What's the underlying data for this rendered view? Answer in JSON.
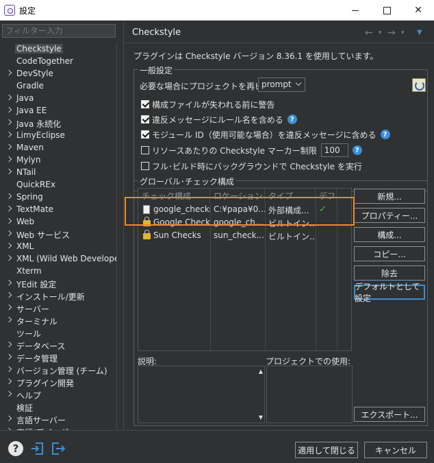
{
  "window": {
    "title": "設定"
  },
  "filter": {
    "placeholder": "フィルター入力"
  },
  "tree": [
    {
      "label": "Checkstyle",
      "expandable": false,
      "selected": true
    },
    {
      "label": "CodeTogether",
      "expandable": false
    },
    {
      "label": "DevStyle",
      "expandable": true
    },
    {
      "label": "Gradle",
      "expandable": false
    },
    {
      "label": "Java",
      "expandable": true
    },
    {
      "label": "Java EE",
      "expandable": true
    },
    {
      "label": "Java 永続化",
      "expandable": true
    },
    {
      "label": "LimyEclipse",
      "expandable": true
    },
    {
      "label": "Maven",
      "expandable": true
    },
    {
      "label": "Mylyn",
      "expandable": true
    },
    {
      "label": "NTail",
      "expandable": true
    },
    {
      "label": "QuickREx",
      "expandable": false
    },
    {
      "label": "Spring",
      "expandable": true
    },
    {
      "label": "TextMate",
      "expandable": true
    },
    {
      "label": "Web",
      "expandable": true
    },
    {
      "label": "Web サービス",
      "expandable": true
    },
    {
      "label": "XML",
      "expandable": true
    },
    {
      "label": "XML (Wild Web Developer",
      "expandable": true
    },
    {
      "label": "Xterm",
      "expandable": false
    },
    {
      "label": "YEdit 設定",
      "expandable": true
    },
    {
      "label": "インストール/更新",
      "expandable": true
    },
    {
      "label": "サーバー",
      "expandable": true
    },
    {
      "label": "ターミナル",
      "expandable": true
    },
    {
      "label": "ツール",
      "expandable": false
    },
    {
      "label": "データベース",
      "expandable": true
    },
    {
      "label": "データ管理",
      "expandable": true
    },
    {
      "label": "バージョン管理 (チーム)",
      "expandable": true
    },
    {
      "label": "プラグイン開発",
      "expandable": true
    },
    {
      "label": "ヘルプ",
      "expandable": true
    },
    {
      "label": "検証",
      "expandable": false
    },
    {
      "label": "言語サーバー",
      "expandable": true
    },
    {
      "label": "実行/デバッグ",
      "expandable": true
    }
  ],
  "page": {
    "title": "Checkstyle",
    "version_line": "プラグインは Checkstyle バージョン 8.36.1 を使用しています。"
  },
  "general": {
    "legend": "一般設定",
    "rebuild_label": "必要な場合にプロジェクトを再ビルド:",
    "rebuild_value": "prompt",
    "options": [
      {
        "label": "構成ファイルが失われる前に警告",
        "checked": true,
        "help": false
      },
      {
        "label": "違反メッセージにルール名を含める",
        "checked": true,
        "help": true
      },
      {
        "label": "モジュール ID（使用可能な場合）を違反メッセージに含める",
        "checked": true,
        "help": true
      },
      {
        "label": "リソースあたりの Checkstyle マーカー制限",
        "checked": false,
        "help": true
      },
      {
        "label": "フル･ビルド時にバックグラウンドで Checkstyle を実行",
        "checked": false,
        "help": false
      }
    ],
    "marker_limit": "100"
  },
  "global": {
    "legend": "グローバル･チェック構成",
    "columns": [
      "チェック構成",
      "ロケーション",
      "タイプ",
      "デフ..."
    ],
    "rows": [
      {
        "name": "google_checks",
        "location": "C:¥papa¥0...",
        "type": "外部構成...",
        "default": "✓",
        "icon": "file"
      },
      {
        "name": "Google Checks",
        "location": "google_ch...",
        "type": "ビルトイン...",
        "default": "",
        "icon": "lock"
      },
      {
        "name": "Sun Checks",
        "location": "sun_check...",
        "type": "ビルトイン...",
        "default": "",
        "icon": "lock"
      }
    ],
    "buttons": {
      "new": "新規...",
      "properties": "プロパティー...",
      "configure": "構成...",
      "copy": "コピー...",
      "remove": "除去",
      "set_default": "デフォルトとして設定",
      "export": "エクスポート..."
    },
    "description_label": "説明:",
    "usage_label": "プロジェクトでの使用:"
  },
  "footer": {
    "apply_close": "適用して閉じる",
    "cancel": "キャンセル",
    "help_glyph": "?"
  },
  "icons": {
    "nav_back": "←",
    "nav_fwd": "→",
    "dropdown": "▾",
    "menu": "▼",
    "close": "✕",
    "scroll_up": "▲",
    "scroll_down": "▼"
  }
}
